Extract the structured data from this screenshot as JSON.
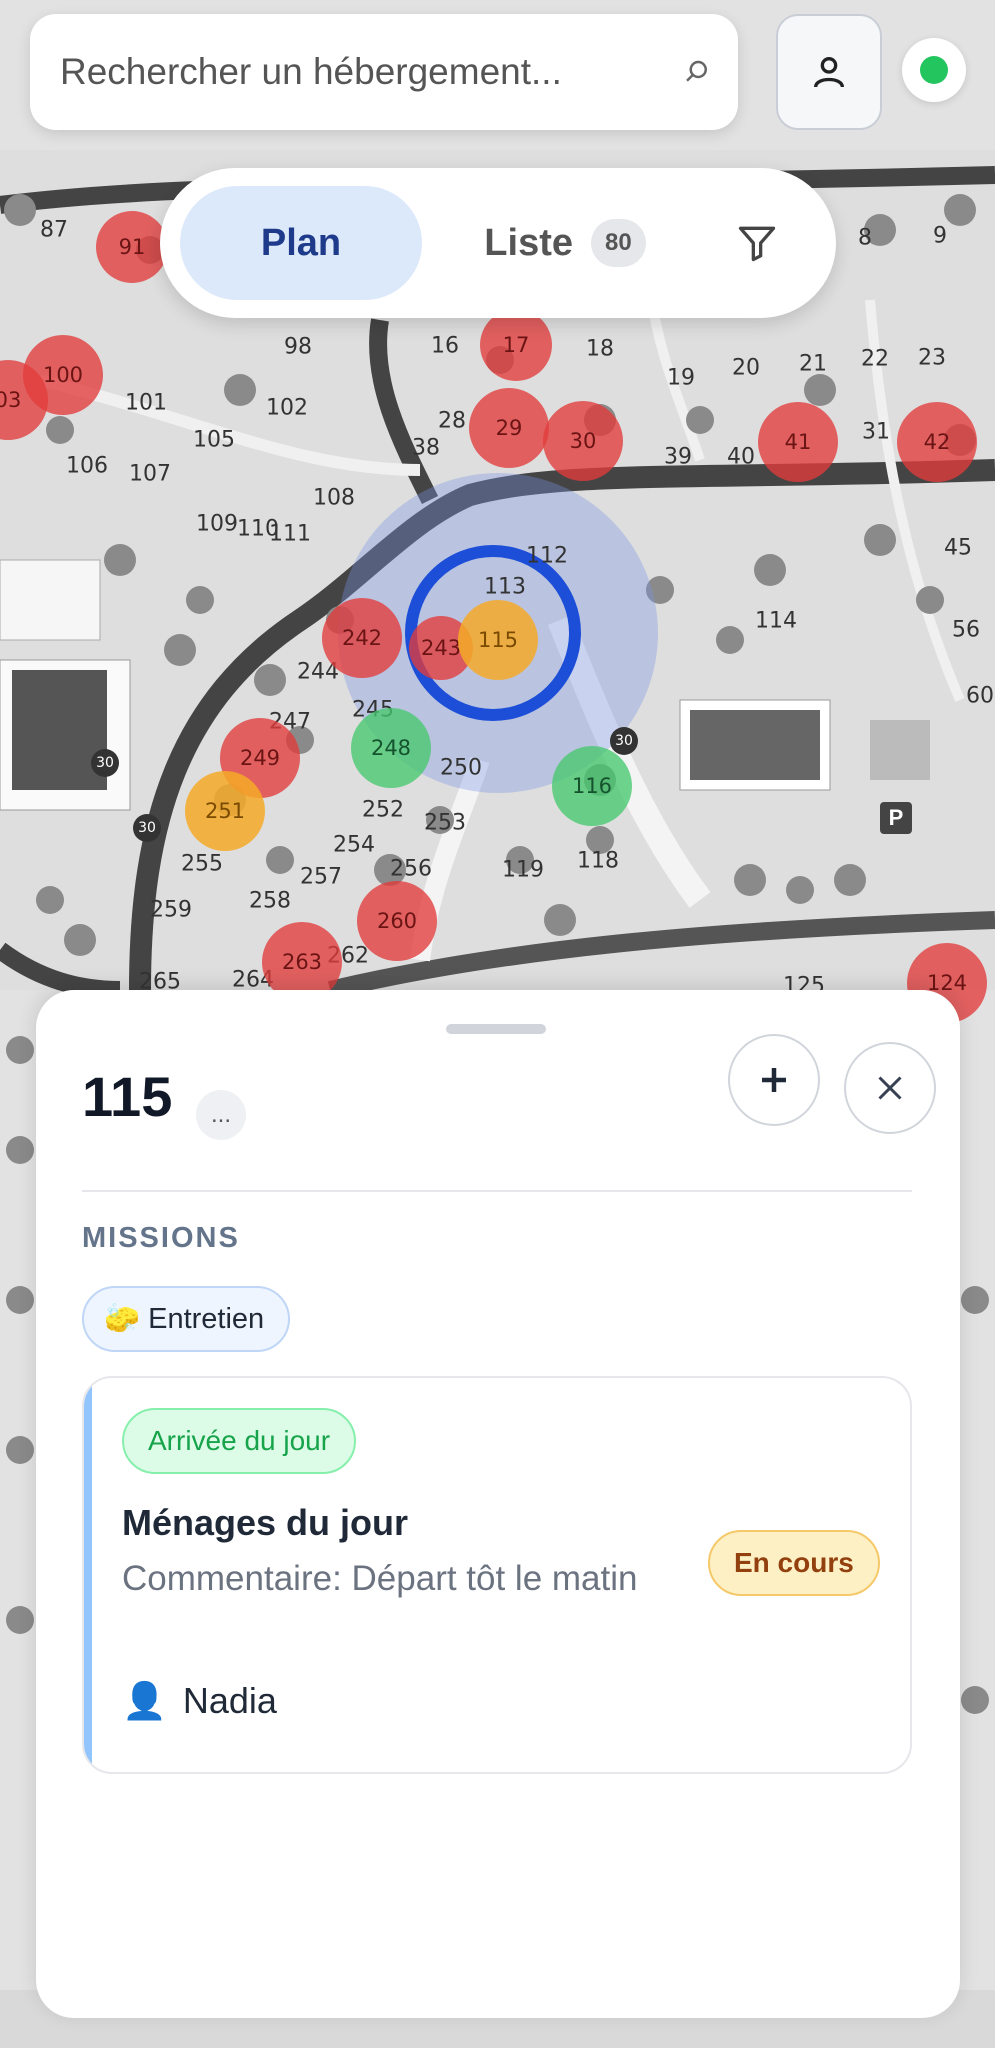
{
  "search": {
    "placeholder": "Rechercher un hébergement..."
  },
  "header": {
    "status_color": "#22c55e"
  },
  "view_toggle": {
    "plan_label": "Plan",
    "liste_label": "Liste",
    "liste_count": "80"
  },
  "map": {
    "lot_numbers": [
      "87",
      "8",
      "9",
      "98",
      "16",
      "18",
      "19",
      "20",
      "21",
      "22",
      "23",
      "101",
      "102",
      "105",
      "28",
      "38",
      "39",
      "40",
      "31",
      "106",
      "107",
      "108",
      "109",
      "110",
      "111",
      "112",
      "45",
      "113",
      "114",
      "56",
      "244",
      "60",
      "247",
      "245",
      "250",
      "252",
      "253",
      "254",
      "255",
      "256",
      "257",
      "258",
      "259",
      "262",
      "264",
      "265",
      "119",
      "118",
      "125"
    ],
    "markers": [
      {
        "label": "91",
        "status": "red"
      },
      {
        "label": "100",
        "status": "red"
      },
      {
        "label": "03",
        "status": "red"
      },
      {
        "label": "17",
        "status": "red"
      },
      {
        "label": "29",
        "status": "red"
      },
      {
        "label": "30",
        "status": "red"
      },
      {
        "label": "41",
        "status": "red"
      },
      {
        "label": "42",
        "status": "red"
      },
      {
        "label": "242",
        "status": "red"
      },
      {
        "label": "243",
        "status": "red"
      },
      {
        "label": "115",
        "status": "orange"
      },
      {
        "label": "249",
        "status": "red"
      },
      {
        "label": "248",
        "status": "green"
      },
      {
        "label": "251",
        "status": "orange"
      },
      {
        "label": "116",
        "status": "green"
      },
      {
        "label": "260",
        "status": "red"
      },
      {
        "label": "263",
        "status": "red"
      },
      {
        "label": "124",
        "status": "red"
      }
    ],
    "speed_signs": [
      "30",
      "30",
      "30"
    ],
    "parking_label": "P"
  },
  "sheet": {
    "title": "115",
    "more_label": "...",
    "missions_heading": "MISSIONS",
    "category_chip": "Entretien",
    "category_emoji": "🧽",
    "mission": {
      "badge": "Arrivée du jour",
      "title": "Ménages du jour",
      "comment": "Commentaire: Départ tôt le matin",
      "status": "En cours",
      "assignee": "Nadia",
      "assignee_icon": "👤"
    }
  }
}
